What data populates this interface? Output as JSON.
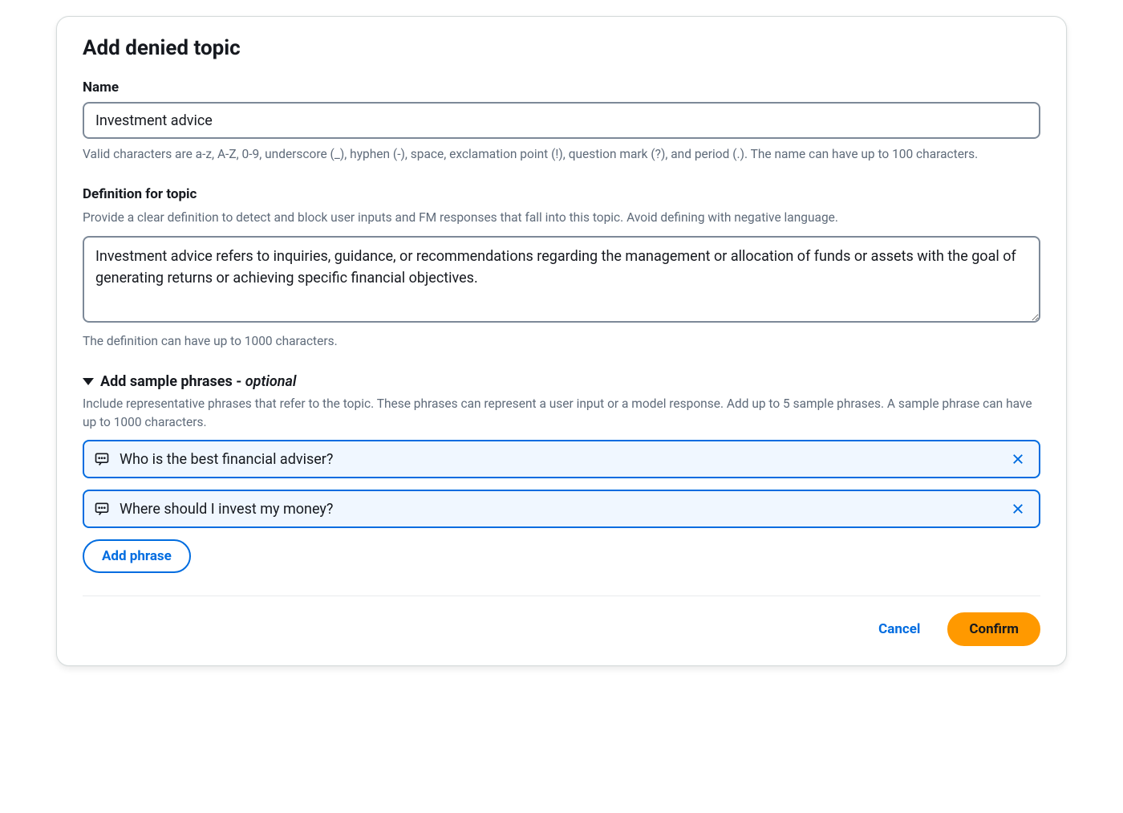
{
  "modal": {
    "title": "Add denied topic"
  },
  "name": {
    "label": "Name",
    "value": "Investment advice",
    "help": "Valid characters are a-z, A-Z, 0-9, underscore (_), hyphen (-), space, exclamation point (!), question mark (?), and period (.). The name can have up to 100 characters."
  },
  "definition": {
    "label": "Definition for topic",
    "sublabel": "Provide a clear definition to detect and block user inputs and FM responses that fall into this topic. Avoid defining with negative language.",
    "value": "Investment advice refers to inquiries, guidance, or recommendations regarding the management or allocation of funds or assets with the goal of generating returns or achieving specific financial objectives.",
    "help": "The definition can have up to 1000 characters."
  },
  "sample_phrases": {
    "header_prefix": "Add sample phrases - ",
    "header_suffix": "optional",
    "sublabel": "Include representative phrases that refer to the topic. These phrases can represent a user input or a model response. Add up to 5 sample phrases. A sample phrase can have up to 1000 characters.",
    "items": [
      {
        "text": "Who is the best financial adviser?"
      },
      {
        "text": "Where should I invest my money?"
      }
    ],
    "add_button": "Add phrase"
  },
  "footer": {
    "cancel": "Cancel",
    "confirm": "Confirm"
  },
  "icons": {
    "chat": "chat-bubble-icon",
    "close": "close-icon",
    "caret": "caret-down-icon"
  }
}
